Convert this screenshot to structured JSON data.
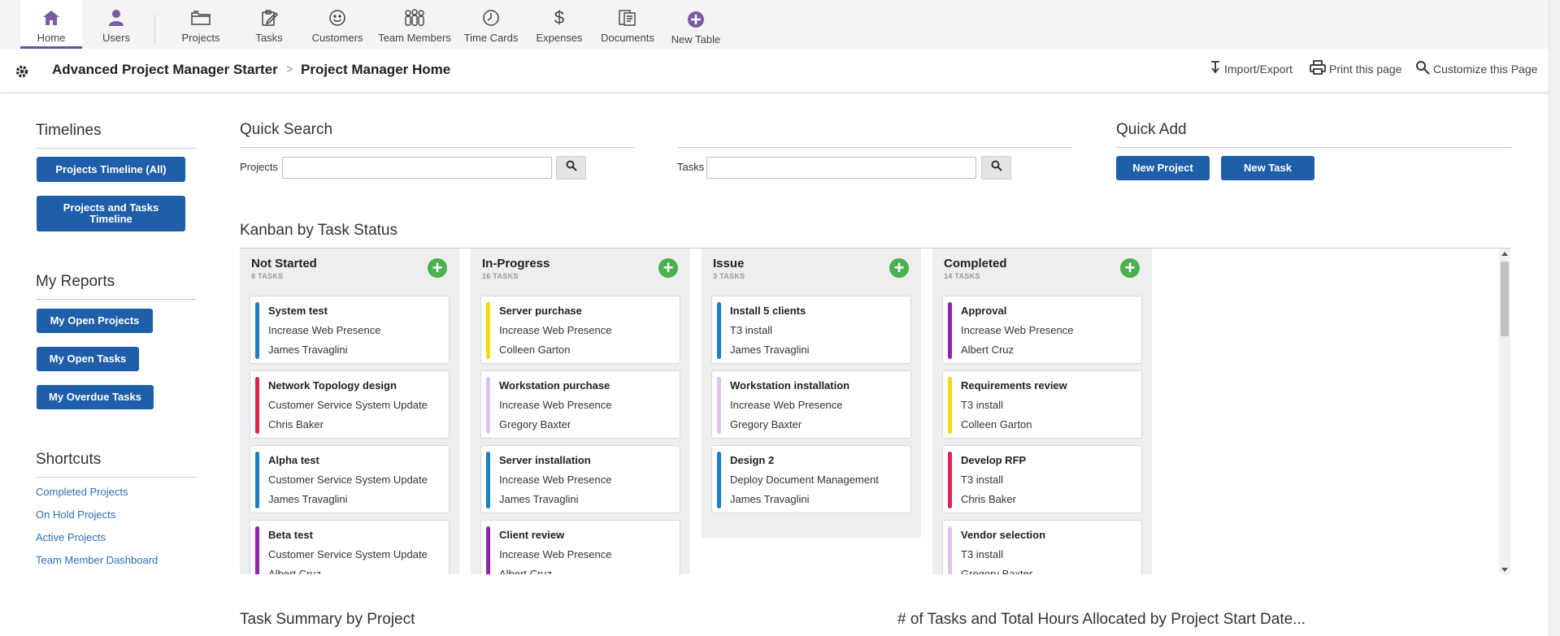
{
  "nav": [
    {
      "label": "Home",
      "icon": "home-icon"
    },
    {
      "label": "Users",
      "icon": "user-icon"
    },
    {
      "label": "Projects",
      "icon": "folders-icon"
    },
    {
      "label": "Tasks",
      "icon": "clipboard-icon"
    },
    {
      "label": "Customers",
      "icon": "smiley-icon"
    },
    {
      "label": "Team Members",
      "icon": "team-icon"
    },
    {
      "label": "Time Cards",
      "icon": "clock-icon"
    },
    {
      "label": "Expenses",
      "icon": "dollar-icon"
    },
    {
      "label": "Documents",
      "icon": "documents-icon"
    },
    {
      "label": "New Table",
      "icon": "plus-circle-icon"
    }
  ],
  "breadcrumb": {
    "app": "Advanced Project Manager Starter",
    "separator": ">",
    "page": "Project Manager Home"
  },
  "tools": {
    "import_export": "Import/Export",
    "print": "Print this page",
    "customize": "Customize this Page"
  },
  "sidebar": {
    "timelines_title": "Timelines",
    "timeline_buttons": [
      "Projects Timeline (All)",
      "Projects and Tasks Timeline"
    ],
    "reports_title": "My Reports",
    "report_buttons": [
      "My Open Projects",
      "My Open Tasks",
      "My Overdue Tasks"
    ],
    "shortcuts_title": "Shortcuts",
    "shortcut_links": [
      "Completed Projects",
      "On Hold Projects",
      "Active Projects",
      "Team Member Dashboard"
    ]
  },
  "quick_search": {
    "title": "Quick Search",
    "projects_label": "Projects",
    "tasks_label": "Tasks",
    "projects_value": "",
    "tasks_value": ""
  },
  "quick_add": {
    "title": "Quick Add",
    "new_project": "New Project",
    "new_task": "New Task"
  },
  "kanban": {
    "title": "Kanban by Task Status",
    "columns": [
      {
        "title": "Not Started",
        "count": "8 TASKS",
        "cards": [
          {
            "name": "System test",
            "project": "Increase Web Presence",
            "person": "James Travaglini",
            "color": "#1e7fc4"
          },
          {
            "name": "Network Topology design",
            "project": "Customer Service System Update",
            "person": "Chris Baker",
            "color": "#e0234e"
          },
          {
            "name": "Alpha test",
            "project": "Customer Service System Update",
            "person": "James Travaglini",
            "color": "#1e7fc4"
          },
          {
            "name": "Beta test",
            "project": "Customer Service System Update",
            "person": "Albert Cruz",
            "color": "#8e24aa"
          }
        ]
      },
      {
        "title": "In-Progress",
        "count": "16 TASKS",
        "cards": [
          {
            "name": "Server purchase",
            "project": "Increase Web Presence",
            "person": "Colleen Garton",
            "color": "#f5d90a"
          },
          {
            "name": "Workstation purchase",
            "project": "Increase Web Presence",
            "person": "Gregory Baxter",
            "color": "#e3c0f0"
          },
          {
            "name": "Server installation",
            "project": "Increase Web Presence",
            "person": "James Travaglini",
            "color": "#1e7fc4"
          },
          {
            "name": "Client review",
            "project": "Increase Web Presence",
            "person": "Albert Cruz",
            "color": "#8e24aa"
          }
        ]
      },
      {
        "title": "Issue",
        "count": "3 TASKS",
        "cards": [
          {
            "name": "Install 5 clients",
            "project": "T3 install",
            "person": "James Travaglini",
            "color": "#1e7fc4"
          },
          {
            "name": "Workstation installation",
            "project": "Increase Web Presence",
            "person": "Gregory Baxter",
            "color": "#e3c0f0"
          },
          {
            "name": "Design 2",
            "project": "Deploy Document Management",
            "person": "James Travaglini",
            "color": "#1e7fc4"
          }
        ]
      },
      {
        "title": "Completed",
        "count": "14 TASKS",
        "cards": [
          {
            "name": "Approval",
            "project": "Increase Web Presence",
            "person": "Albert Cruz",
            "color": "#8e24aa"
          },
          {
            "name": "Requirements review",
            "project": "T3 install",
            "person": "Colleen Garton",
            "color": "#f5d90a"
          },
          {
            "name": "Develop RFP",
            "project": "T3 install",
            "person": "Chris Baker",
            "color": "#e0234e"
          },
          {
            "name": "Vendor selection",
            "project": "T3 install",
            "person": "Gregory Baxter",
            "color": "#e3c0f0"
          }
        ]
      }
    ]
  },
  "bottom": {
    "task_summary_title": "Task Summary by Project",
    "tasks_hours_title": "# of Tasks and Total Hours Allocated by Project Start Date..."
  }
}
